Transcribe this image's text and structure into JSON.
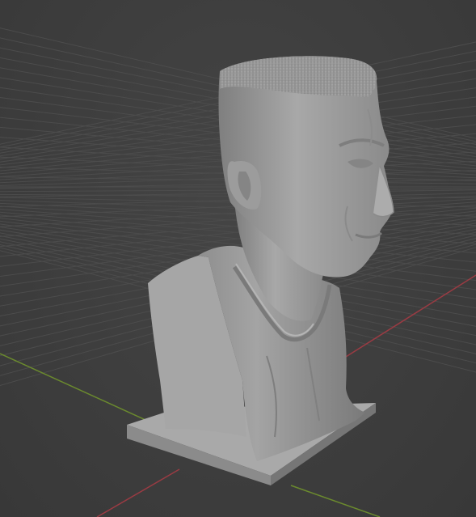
{
  "app": {
    "view": "3D Viewport"
  },
  "scene": {
    "object": "bust-sculpt",
    "axis_x_color": "#9a3b43",
    "axis_y_color": "#6b8a2e",
    "grid_color": "#4c4c4c",
    "background_color": "#3d3d3d",
    "model_color": "#9d9d9d"
  }
}
